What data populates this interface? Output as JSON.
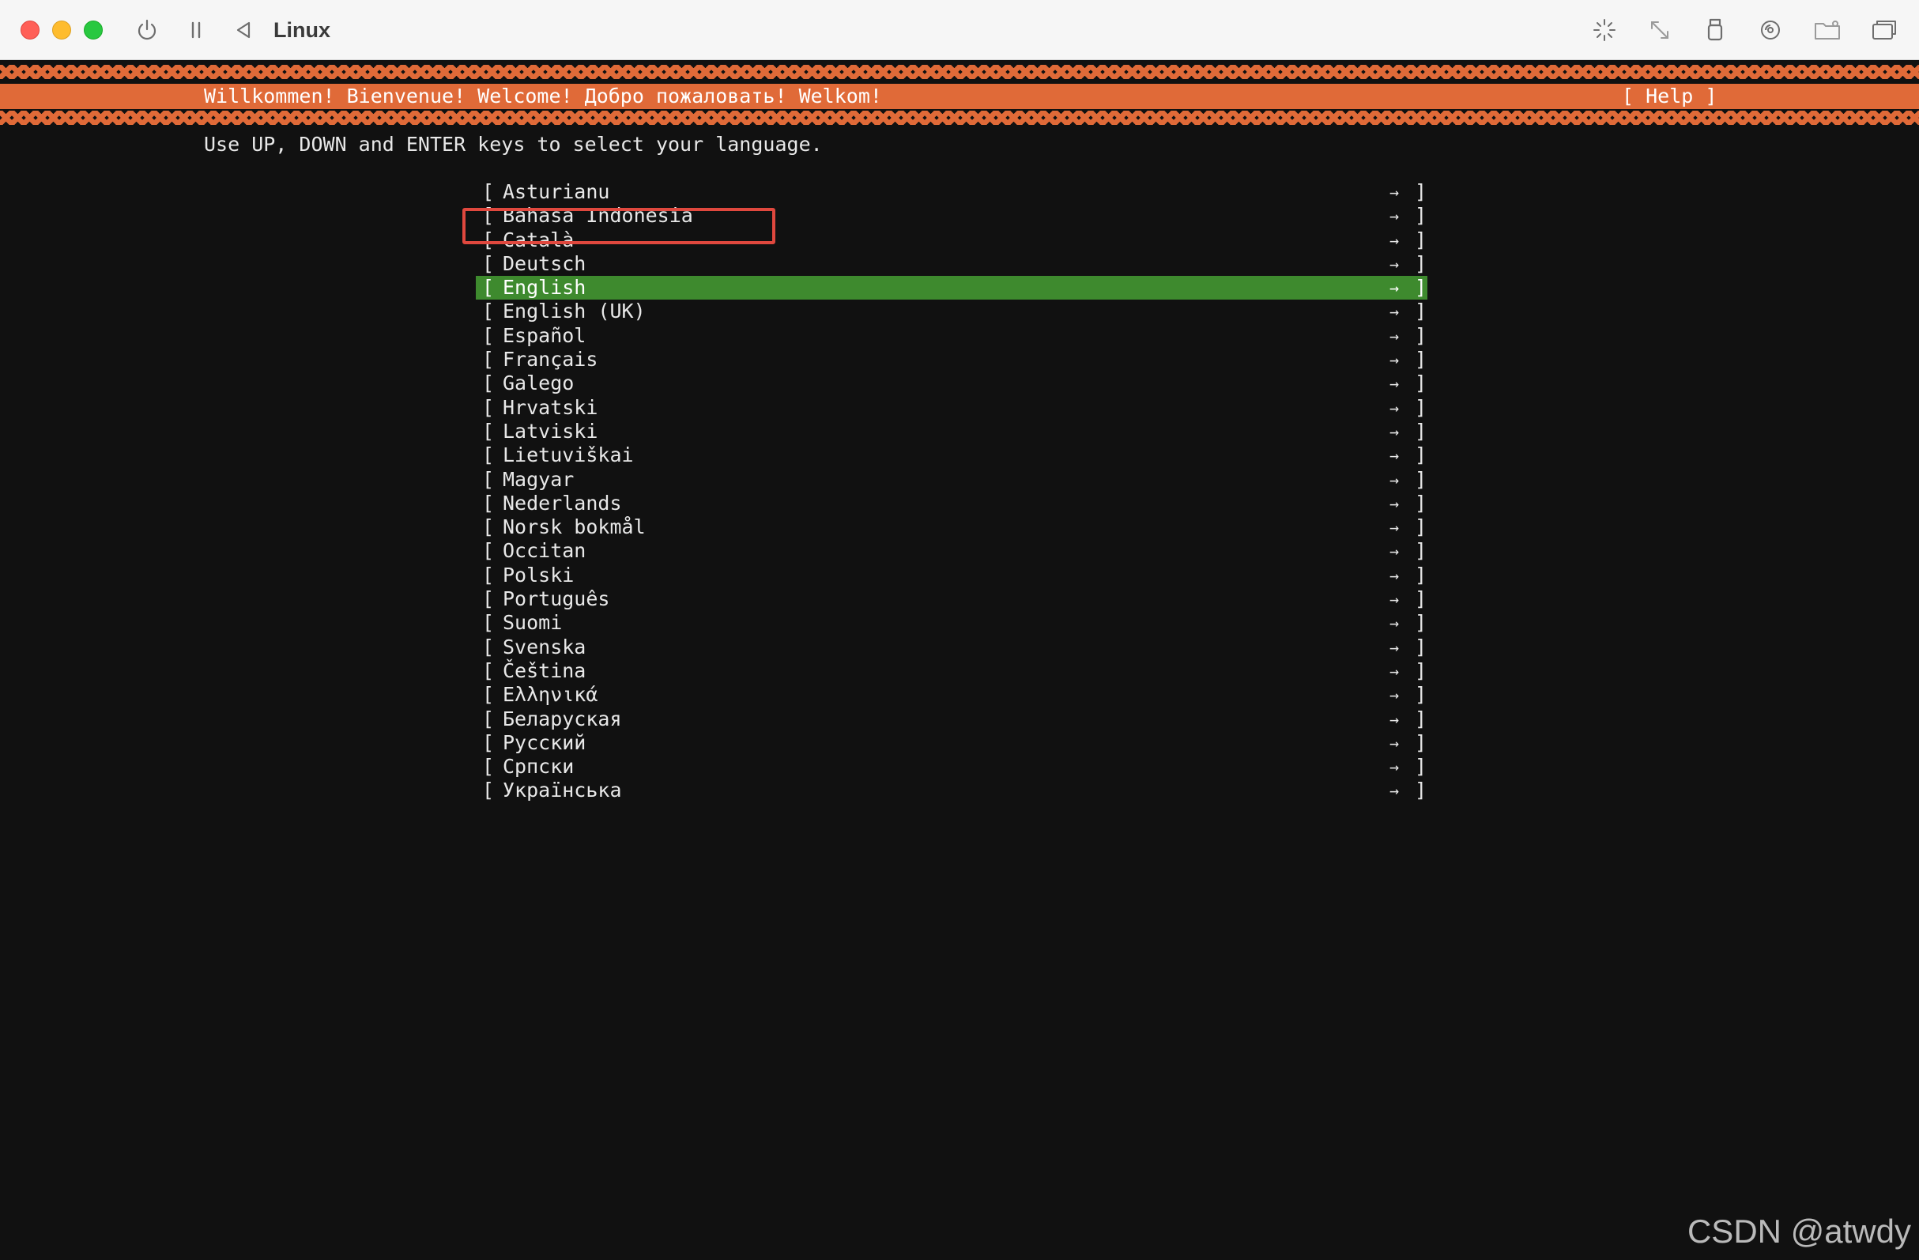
{
  "window": {
    "title": "Linux"
  },
  "toolbar": {
    "icons": [
      "power-icon",
      "pause-icon",
      "back-icon",
      "cursor-capture-icon",
      "resize-icon",
      "usb-icon",
      "disc-icon",
      "shared-folder-icon",
      "display-icon"
    ]
  },
  "installer": {
    "header": "Willkommen! Bienvenue! Welcome! Добро пожаловать! Welkom!",
    "help_label": "[ Help ]",
    "instructions": "Use UP, DOWN and ENTER keys to select your language.",
    "bracket_left": "[",
    "bracket_right": "]",
    "arrow": "→",
    "selected_index": 4,
    "languages": [
      {
        "label": "Asturianu"
      },
      {
        "label": "Bahasa Indonesia"
      },
      {
        "label": "Català"
      },
      {
        "label": "Deutsch"
      },
      {
        "label": "English"
      },
      {
        "label": "English (UK)"
      },
      {
        "label": "Español"
      },
      {
        "label": "Français"
      },
      {
        "label": "Galego"
      },
      {
        "label": "Hrvatski"
      },
      {
        "label": "Latviski"
      },
      {
        "label": "Lietuviškai"
      },
      {
        "label": "Magyar"
      },
      {
        "label": "Nederlands"
      },
      {
        "label": "Norsk bokmål"
      },
      {
        "label": "Occitan"
      },
      {
        "label": "Polski"
      },
      {
        "label": "Português"
      },
      {
        "label": "Suomi"
      },
      {
        "label": "Svenska"
      },
      {
        "label": "Čeština"
      },
      {
        "label": "Ελληνικά"
      },
      {
        "label": "Беларуская"
      },
      {
        "label": "Русский"
      },
      {
        "label": "Српски"
      },
      {
        "label": "Українська"
      }
    ]
  },
  "colors": {
    "accent_orange": "#e06a38",
    "selection_green": "#3e8a2e",
    "annotation_red": "#e0483e",
    "terminal_bg": "#111111"
  },
  "watermark": "CSDN @atwdy"
}
